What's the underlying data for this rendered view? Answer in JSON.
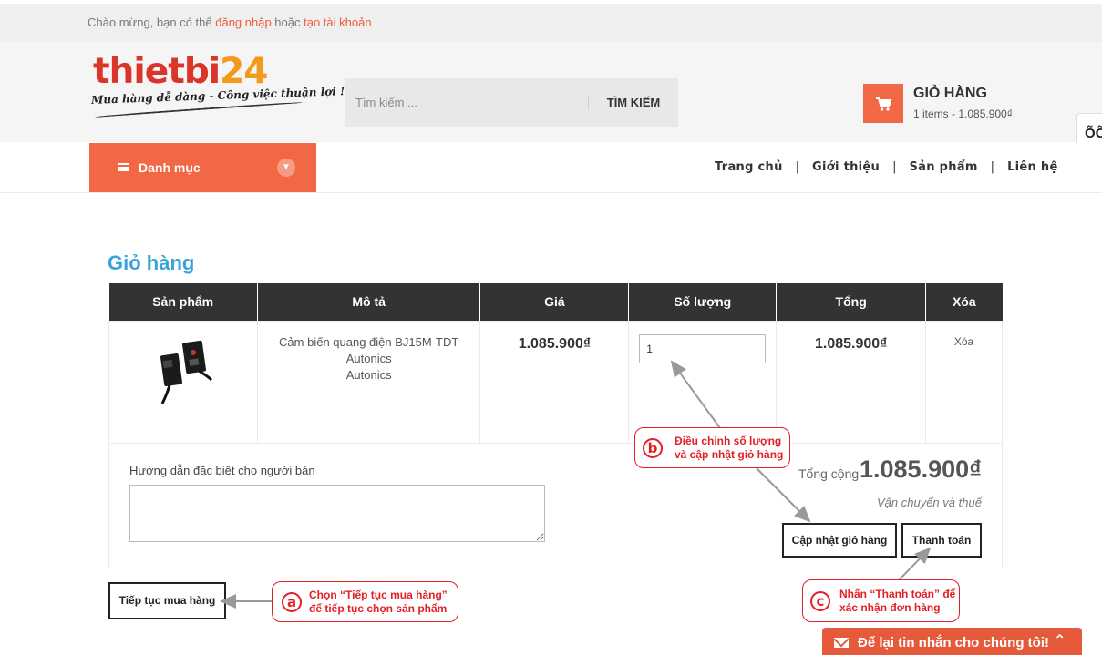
{
  "topbar": {
    "welcome": "Chào mừng, bạn có thể ",
    "login": "đăng nhập",
    "or": " hoặc ",
    "register": "tạo tài khoản"
  },
  "logo": {
    "word_main": "thietbi",
    "word_num": "24",
    "slogan": "Mua hàng dễ dàng - Công việc thuận lợi !"
  },
  "search": {
    "placeholder": "Tìm kiếm ...",
    "button": "TÌM KIẾM"
  },
  "header_cart": {
    "title": "GIỎ HÀNG",
    "summary": "1 items - 1.085.900₫"
  },
  "side_widget": {
    "label": "ÕÕ"
  },
  "nav": {
    "category": "Danh mục",
    "items": [
      "Trang chủ",
      "Giới thiệu",
      "Sản phẩm",
      "Liên hệ"
    ],
    "separator": "|"
  },
  "cart_page": {
    "title": "Giỏ hàng",
    "columns": [
      "Sản phẩm",
      "Mô tả",
      "Giá",
      "Số lượng",
      "Tổng",
      "Xóa"
    ],
    "rows": [
      {
        "name": "Cảm biến quang điện BJ15M-TDT",
        "brand1": "Autonics",
        "brand2": "Autonics",
        "price": "1.085.900₫",
        "quantity": "1",
        "total": "1.085.900₫",
        "delete": "Xóa"
      }
    ],
    "note_label": "Hướng dẫn đặc biệt cho người bán",
    "total_label": "Tổng cộng",
    "total_value": "1.085.900₫",
    "shipping_note": "Vận chuyển và thuế",
    "update_button": "Cập nhật giỏ hàng",
    "checkout_button": "Thanh toán",
    "continue_button": "Tiếp tục mua hàng"
  },
  "annotations": {
    "a": {
      "letter": "a",
      "line1": "Chọn “Tiếp tục mua hàng”",
      "line2": "để tiếp tục chọn sản phẩm"
    },
    "b": {
      "letter": "b",
      "line1": "Điều chỉnh số lượng",
      "line2": "và cập nhật giỏ hàng"
    },
    "c": {
      "letter": "c",
      "line1": "Nhấn “Thanh toán” để",
      "line2": "xác nhận đơn hàng"
    },
    "color": "#e31f26"
  },
  "chat": {
    "label": "Để lại tin nhắn cho chúng tôi!",
    "icon": "mail-icon"
  },
  "colors": {
    "accent": "#f26744",
    "title_blue": "#3aa4d8",
    "table_header": "#333333"
  }
}
